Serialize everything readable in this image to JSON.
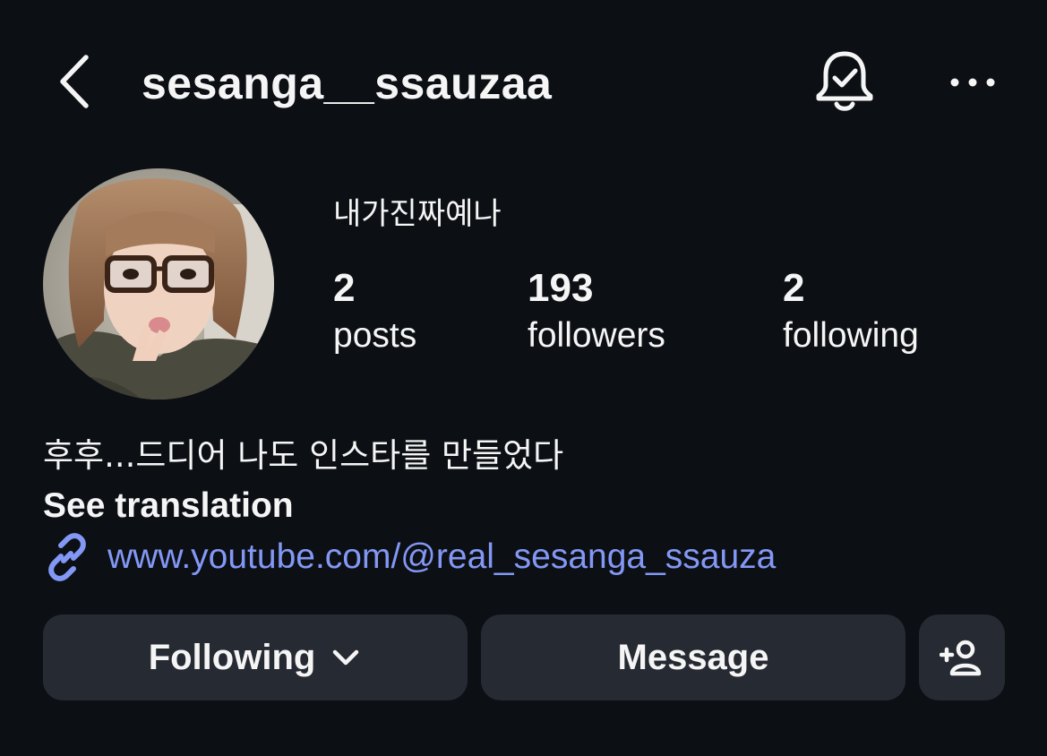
{
  "header": {
    "username": "sesanga__ssauzaa",
    "back_icon": "chevron-left-icon",
    "notification_icon": "bell-check-icon",
    "more_icon": "more-horizontal-icon"
  },
  "profile": {
    "display_name": "내가진짜예나",
    "avatar": "profile-photo",
    "stats": [
      {
        "count": "2",
        "label": "posts"
      },
      {
        "count": "193",
        "label": "followers"
      },
      {
        "count": "2",
        "label": "following"
      }
    ]
  },
  "bio": {
    "text": "후후...드디어 나도 인스타를 만들었다",
    "translate_label": "See translation",
    "link_icon": "link-icon",
    "link": "www.youtube.com/@real_sesanga_ssauza"
  },
  "actions": {
    "following_label": "Following",
    "following_icon": "chevron-down-icon",
    "message_label": "Message",
    "add_user_icon": "add-person-icon"
  },
  "colors": {
    "background": "#0c0f14",
    "button": "#262a32",
    "link": "#8398f5",
    "text": "#f5f5f5"
  }
}
